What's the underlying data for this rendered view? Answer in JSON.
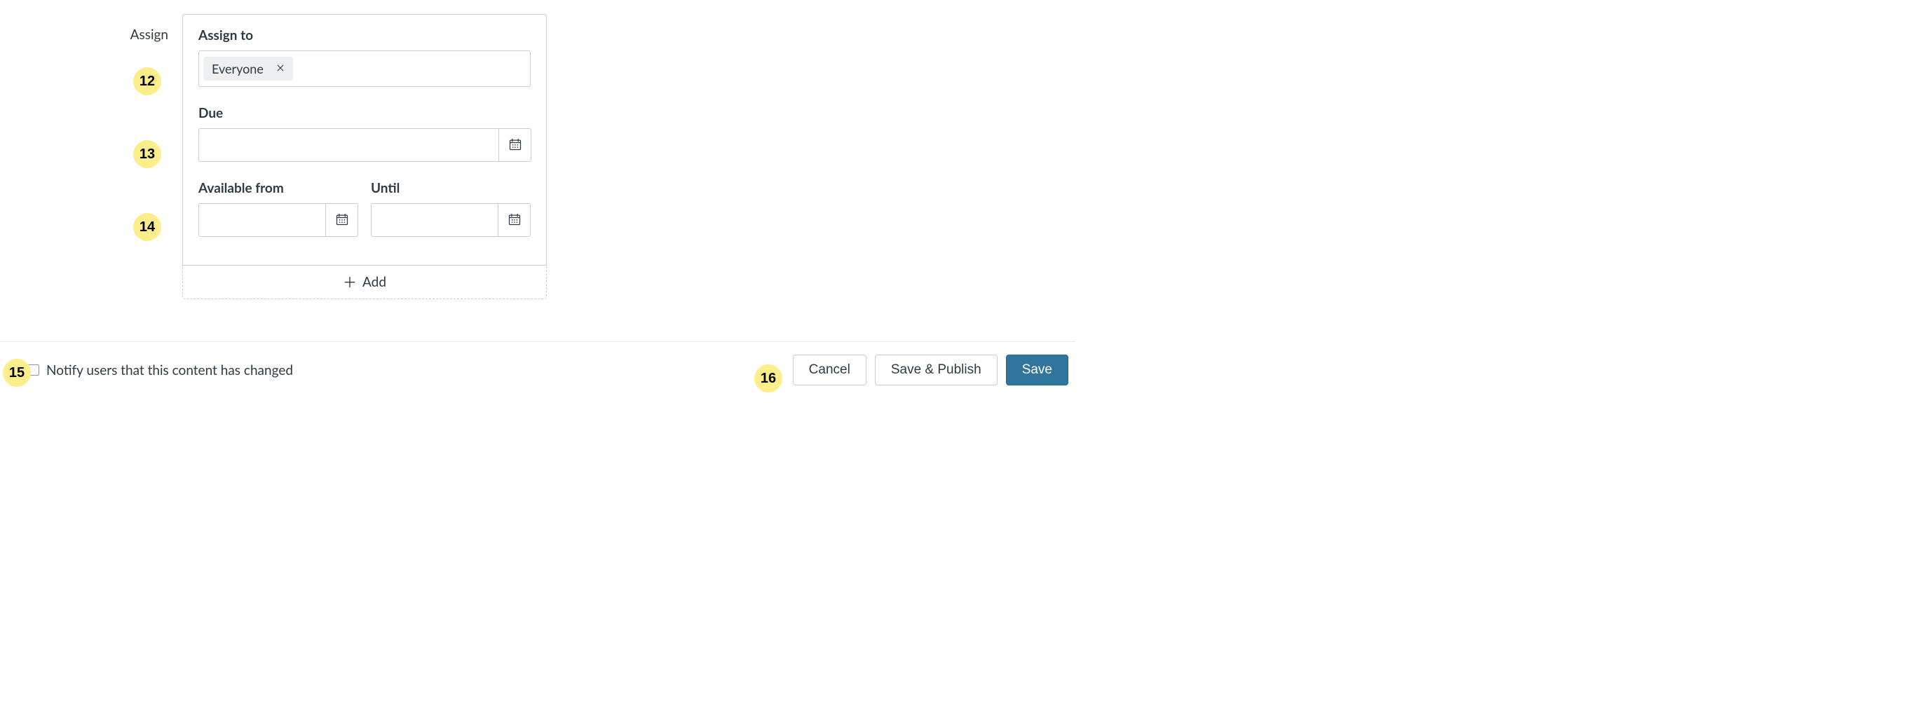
{
  "row_label": "Assign",
  "sections": {
    "assign_to": {
      "label": "Assign to",
      "pill": "Everyone"
    },
    "due": {
      "label": "Due",
      "value": ""
    },
    "available_from": {
      "label": "Available from",
      "value": ""
    },
    "until": {
      "label": "Until",
      "value": ""
    }
  },
  "add_label": "Add",
  "footer": {
    "notify_label": "Notify users that this content has changed",
    "cancel": "Cancel",
    "save_publish": "Save & Publish",
    "save": "Save"
  },
  "markers": {
    "m12": "12",
    "m13": "13",
    "m14": "14",
    "m15": "15",
    "m16": "16"
  }
}
